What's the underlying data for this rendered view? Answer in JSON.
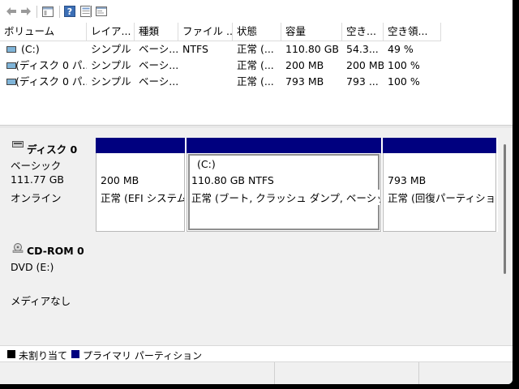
{
  "columns": [
    "ボリューム",
    "レイア...",
    "種類",
    "ファイル ...",
    "状態",
    "容量",
    "空き...",
    "空き領..."
  ],
  "rows": [
    {
      "volume": "(C:)",
      "layout": "シンプル",
      "type": "ベーシ...",
      "fs": "NTFS",
      "status": "正常 (...",
      "capacity": "110.80 GB",
      "free": "54.3...",
      "free_pct": "49 %"
    },
    {
      "volume": "(ディスク 0 パ...",
      "layout": "シンプル",
      "type": "ベーシ...",
      "fs": "",
      "status": "正常 (...",
      "capacity": "200 MB",
      "free": "200 MB",
      "free_pct": "100 %"
    },
    {
      "volume": "(ディスク 0 パ...",
      "layout": "シンプル",
      "type": "ベーシ...",
      "fs": "",
      "status": "正常 (...",
      "capacity": "793 MB",
      "free": "793 ...",
      "free_pct": "100 %"
    }
  ],
  "disk0": {
    "name": "ディスク 0",
    "type": "ベーシック",
    "size": "111.77 GB",
    "state": "オンライン",
    "partitions": [
      {
        "label": "",
        "size": "200 MB",
        "status": "正常 (EFI システム"
      },
      {
        "label": "(C:)",
        "size": "110.80 GB NTFS",
        "status": "正常 (ブート, クラッシュ ダンプ, ベーシック デ"
      },
      {
        "label": "",
        "size": "793 MB",
        "status": "正常 (回復パーティショ"
      }
    ]
  },
  "cdrom0": {
    "name": "CD-ROM 0",
    "drive": "DVD (E:)",
    "media": "メディアなし"
  },
  "legend": {
    "unallocated": "未割り当て",
    "primary": "プライマリ パーティション"
  },
  "colors": {
    "primary_partition": "#00007f",
    "unallocated": "#000000"
  }
}
